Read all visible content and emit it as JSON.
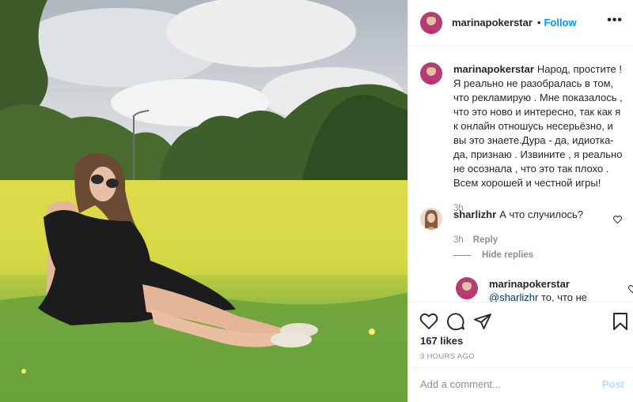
{
  "header": {
    "username": "marinapokerstar",
    "separator": "•",
    "follow_label": "Follow",
    "more_glyph": "•••"
  },
  "caption": {
    "username": "marinapokerstar",
    "text": "Народ, простите ! Я реально не разобралась в том, что рекламирую . Мне показалось , что это ново и интересно, так как я к онлайн отношусь несерьёзно, и вы это знаете.Дура - да, идиотка- да, признаю . Извините , я реально не осознала , что это так плохо . Всем хорошей и честной игры!",
    "time": "3h"
  },
  "comment1": {
    "username": "sharlizhr",
    "text": "А что случилось?",
    "time": "3h",
    "reply_label": "Reply"
  },
  "hide_replies_label": "Hide replies",
  "reply1": {
    "username": "marinapokerstar",
    "mention": "@sharlizhr",
    "text": " то, что не"
  },
  "actions": {
    "likes": "167 likes",
    "time_ago": "3 HOURS AGO",
    "comment_placeholder": "Add a comment...",
    "post_label": "Post"
  },
  "icons": {
    "like": "heart-icon",
    "comment": "comment-bubble-icon",
    "share": "paper-plane-icon",
    "save": "bookmark-icon",
    "more": "ellipsis-icon"
  },
  "colors": {
    "accent": "#0095f6",
    "text": "#262626",
    "muted": "#8e8e8e",
    "post_disabled": "#b2dffc"
  }
}
